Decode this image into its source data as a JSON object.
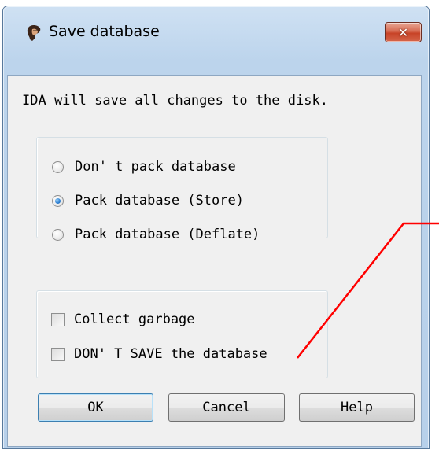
{
  "dialog": {
    "title": "Save database",
    "message": "IDA will save all changes to the disk."
  },
  "pack_options": [
    {
      "label": "Don' t pack database",
      "checked": false
    },
    {
      "label": "Pack database (Store)",
      "checked": true
    },
    {
      "label": "Pack database (Deflate)",
      "checked": false
    }
  ],
  "checkboxes": [
    {
      "label": "Collect garbage",
      "checked": false
    },
    {
      "label": "DON' T SAVE the database",
      "checked": false
    }
  ],
  "buttons": {
    "ok": "OK",
    "cancel": "Cancel",
    "help": "Help"
  },
  "title_buttons": {
    "close": "✕"
  },
  "colors": {
    "annotation_line": "#ff0000",
    "frame": "#b7d0ea"
  }
}
